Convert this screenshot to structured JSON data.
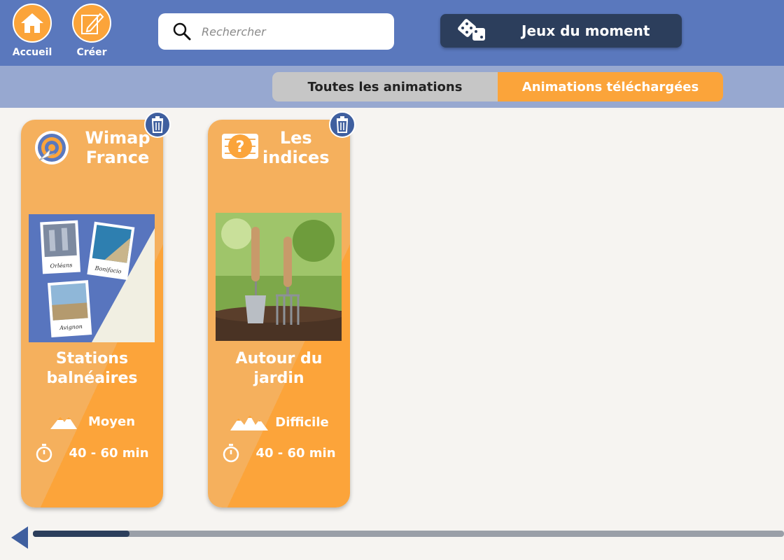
{
  "nav": {
    "home_label": "Accueil",
    "create_label": "Créer"
  },
  "search": {
    "placeholder": "Rechercher",
    "value": ""
  },
  "games_button": {
    "label": "Jeux du moment"
  },
  "tabs": [
    {
      "label": "Toutes les animations",
      "active": false
    },
    {
      "label": "Animations téléchargées",
      "active": true
    }
  ],
  "cards": [
    {
      "category": "Wimap France",
      "category_line1": "Wimap",
      "category_line2": "France",
      "category_icon": "target-icon",
      "image_captions": [
        "Orléans",
        "Bonifacio",
        "Avignon"
      ],
      "name_line1": "Stations",
      "name_line2": "balnéaires",
      "difficulty": "Moyen",
      "duration": "40 - 60 min"
    },
    {
      "category": "Les indices",
      "category_line1": "Les",
      "category_line2": "indices",
      "category_icon": "question-ticket-icon",
      "name_line1": "Autour du",
      "name_line2": "jardin",
      "difficulty": "Difficile",
      "duration": "40 - 60 min"
    }
  ],
  "colors": {
    "topbar": "#5a78bd",
    "accent": "#fba43a",
    "dark": "#2c3e5c",
    "subbar": "#97a8d0"
  }
}
